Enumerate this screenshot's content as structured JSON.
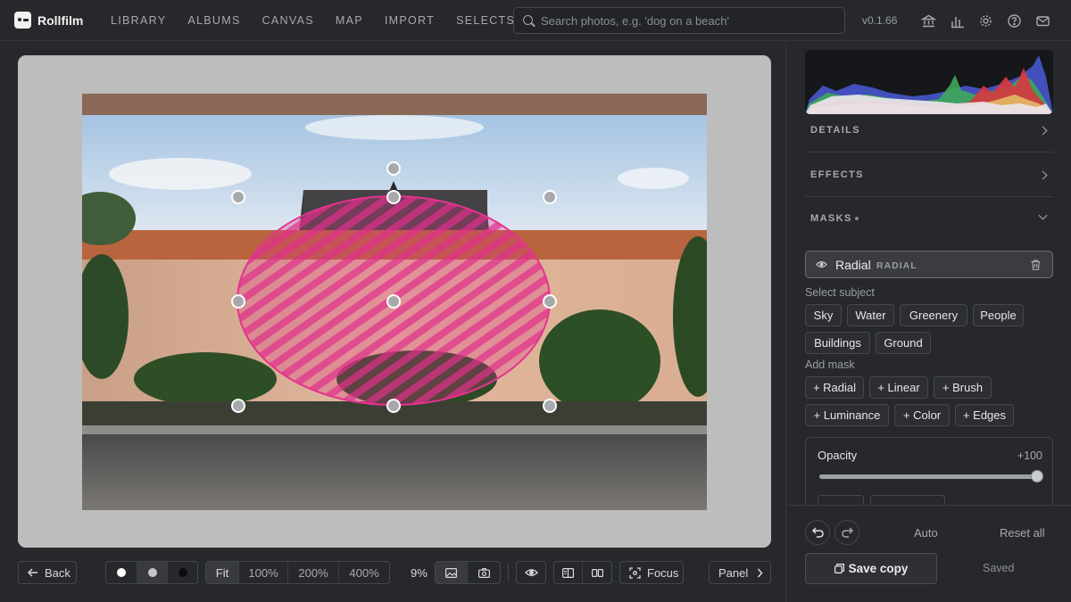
{
  "app": {
    "name": "Rollfilm",
    "version": "v0.1.66"
  },
  "nav": {
    "items": [
      "LIBRARY",
      "ALBUMS",
      "CANVAS",
      "MAP",
      "IMPORT",
      "SELECTS"
    ]
  },
  "search": {
    "placeholder": "Search photos, e.g. 'dog on a beach'",
    "value": ""
  },
  "header_icons": [
    "bank-icon",
    "stats-icon",
    "gear-icon",
    "help-icon",
    "mail-icon"
  ],
  "toolbar": {
    "back_label": "Back",
    "zoom_options": [
      "Fit",
      "100%",
      "200%",
      "400%"
    ],
    "zoom_active": "Fit",
    "zoom_level": "9%",
    "focus_label": "Focus",
    "panel_label": "Panel"
  },
  "panel": {
    "sections": {
      "details": "DETAILS",
      "effects": "EFFECTS",
      "masks": "MASKS"
    },
    "mask": {
      "name": "Radial",
      "type": "RADIAL"
    },
    "select_subject_label": "Select subject",
    "subjects": [
      "Sky",
      "Water",
      "Greenery",
      "People",
      "Buildings",
      "Ground"
    ],
    "add_mask_label": "Add mask",
    "add_masks": [
      "+ Radial",
      "+ Linear",
      "+ Brush",
      "+ Luminance",
      "+ Color",
      "+ Edges"
    ],
    "opacity": {
      "label": "Opacity",
      "value_text": "+100",
      "value": 100
    },
    "auto_label": "Auto",
    "reset_label": "Reset all",
    "save_label": "Save copy",
    "saved_label": "Saved"
  },
  "colors": {
    "accent_mask": "#e0308a",
    "background": "#26282c",
    "canvas": "#bdbdbd"
  }
}
